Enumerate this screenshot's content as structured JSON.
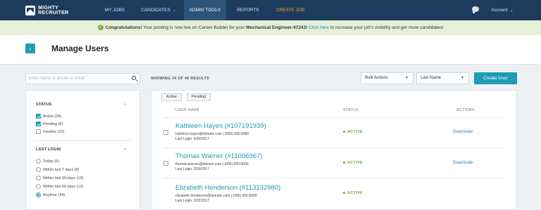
{
  "brand": {
    "line1": "MIGHTY",
    "line2": "RECRUITER"
  },
  "nav": {
    "items": [
      {
        "label": "MY JOBS"
      },
      {
        "label": "CANDIDATES"
      },
      {
        "label": "ADMIN TOOLS"
      },
      {
        "label": "REPORTS"
      },
      {
        "label": "CREATE JOB"
      }
    ],
    "account_label": "Account"
  },
  "banner": {
    "lead": "Congratulations!",
    "text1": " Your posting is now live on Career Builder for your ",
    "job": "Mechanical Engineer-47243!",
    "link": "Click here",
    "text2": " to increase your job's visibility and get more candidates!"
  },
  "page": {
    "title": "Manage Users"
  },
  "search": {
    "placeholder": "Enter name or phone or email"
  },
  "filters": {
    "status_heading": "STATUS",
    "status_options": [
      {
        "label": "Active (28)",
        "checked": true
      },
      {
        "label": "Pending (6)",
        "checked": true
      },
      {
        "label": "Inactive (12)",
        "checked": false
      }
    ],
    "login_heading": "LAST LOGIN",
    "login_options": [
      {
        "label": "Today (5)",
        "checked": false
      },
      {
        "label": "Within last 7 days (8)",
        "checked": false
      },
      {
        "label": "Within last 30 days (10)",
        "checked": false
      },
      {
        "label": "Within last 60 days (12)",
        "checked": false
      },
      {
        "label": "Anytime (34)",
        "checked": true
      }
    ]
  },
  "results": {
    "count_text": "SHOWING 34 OF 46 RESULTS",
    "bulk_actions": "Bulk Actions",
    "sort_by": "Last Name",
    "create_button": "Create User"
  },
  "table": {
    "chips": [
      "Active",
      "Pending"
    ],
    "headers": {
      "name": "USER NAME",
      "status": "STATUS",
      "actions": "ACTIONS"
    },
    "rows": [
      {
        "name": "Kathleen Hayes (#107191939)",
        "contact": "kathleen.hayes@domain.com  | (000) 000-0000",
        "last_login": "Last Login: 4/30/2017",
        "status": "ACTIVE",
        "action": "Deactivate"
      },
      {
        "name": "Thomas Warner (#11006967)",
        "contact": "thomas.warner@domain.com  | (000) 000-0000",
        "last_login": "Last Login: 3/30/2017",
        "status": "ACTIVE",
        "action": "Deactivate"
      },
      {
        "name": "Elizabeth Henderson (#113132980)",
        "contact": "elizabeth.henderson@domain.com  | (000) 000-0000",
        "last_login": "Last Login: 3/22/2017",
        "status": "ACTIVE",
        "action": ""
      }
    ]
  }
}
